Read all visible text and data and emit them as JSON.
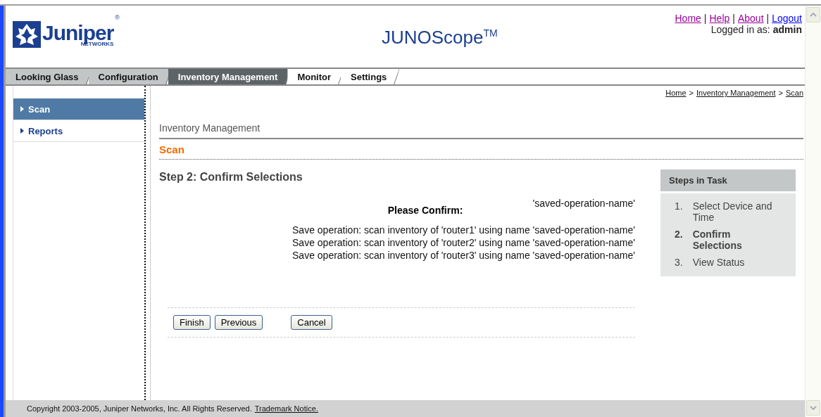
{
  "header": {
    "logo": {
      "name": "Juniper",
      "sub": "NETWORKS",
      "mark": "®"
    },
    "title": "JUNOScope$^{TM}$",
    "links": [
      {
        "label": "Home",
        "color": "#990099"
      },
      {
        "label": "Help",
        "color": "#990099"
      },
      {
        "label": "About",
        "color": "#990099"
      },
      {
        "label": "Logout",
        "color": "#0000ff"
      }
    ],
    "link_separator": "|",
    "login_label": "Logged in as:",
    "login_user": "admin"
  },
  "tabs": [
    {
      "label": "Looking Glass",
      "selected": false
    },
    {
      "label": "Configuration",
      "selected": false
    },
    {
      "label": "Inventory Management",
      "selected": true
    },
    {
      "label": "Monitor",
      "selected": false
    },
    {
      "label": "Settings",
      "selected": false
    }
  ],
  "sidebar": {
    "items": [
      {
        "label": "Scan",
        "selected": true
      },
      {
        "label": "Reports",
        "selected": false
      }
    ]
  },
  "breadcrumb": {
    "separator": ">",
    "items": [
      "Home",
      "Inventory Management",
      "Scan"
    ]
  },
  "section_title": "Inventory Management",
  "page_title": "Scan",
  "step_title": "Step 2: Confirm Selections",
  "confirm": {
    "operation_name": "'saved-operation-name'",
    "heading": "Please Confirm:",
    "lines": [
      "Save operation: scan inventory of 'router1' using name 'saved-operation-name'",
      "Save operation: scan inventory of 'router2' using name 'saved-operation-name'",
      "Save operation: scan inventory of 'router3' using name 'saved-operation-name'"
    ]
  },
  "buttons": [
    "Finish",
    "Previous",
    "Cancel"
  ],
  "steps": {
    "title": "Steps in Task",
    "items": [
      {
        "number": "1.",
        "label": "Select Device and Time",
        "current": false
      },
      {
        "number": "2.",
        "label": "Confirm Selections",
        "current": true
      },
      {
        "number": "3.",
        "label": "View Status",
        "current": false
      }
    ]
  },
  "footer": {
    "copyright": "Copyright 2003-2005, Juniper Networks, Inc. All Rights Reserved.",
    "link": "Trademark Notice."
  }
}
